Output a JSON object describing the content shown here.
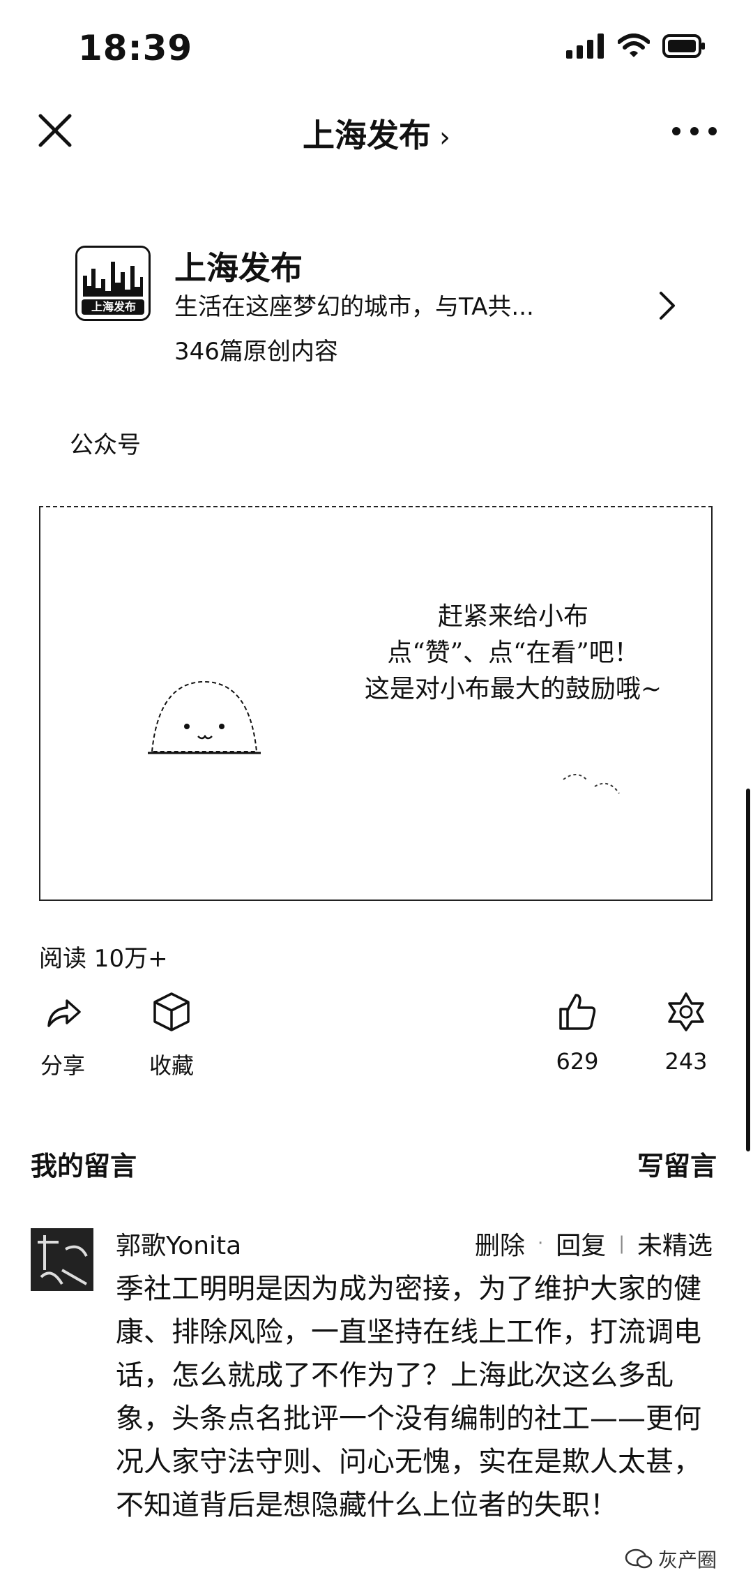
{
  "status_bar": {
    "time": "18:39"
  },
  "nav": {
    "title": "上海发布",
    "chevron": "›"
  },
  "account": {
    "name": "上海发布",
    "description": "生活在这座梦幻的城市，与TA共...",
    "original_count": "346篇原创内容",
    "avatar_text": "上海发布",
    "type": "公众号"
  },
  "image_card": {
    "lines": [
      "赶紧来给小布",
      "点“赞”、点“在看”吧！",
      "这是对小布最大的鼓励哦~"
    ]
  },
  "read_count": "阅读 10万+",
  "actions": {
    "share": "分享",
    "favorite": "收藏",
    "like_count": "629",
    "wow_count": "243"
  },
  "comments_section": {
    "title": "我的留言",
    "write": "写留言"
  },
  "comment": {
    "author": "郭歌Yonita",
    "delete": "删除",
    "reply": "回复",
    "status": "未精选",
    "text": "季社工明明是因为成为密接，为了维护大家的健康、排除风险，一直坚持在线上工作，打流调电话，怎么就成了不作为了？上海此次这么多乱象，头条点名批评一个没有编制的社工——更何况人家守法守则、问心无愧，实在是欺人太甚，不知道背后是想隐藏什么上位者的失职！"
  },
  "watermark": "灰产圈"
}
